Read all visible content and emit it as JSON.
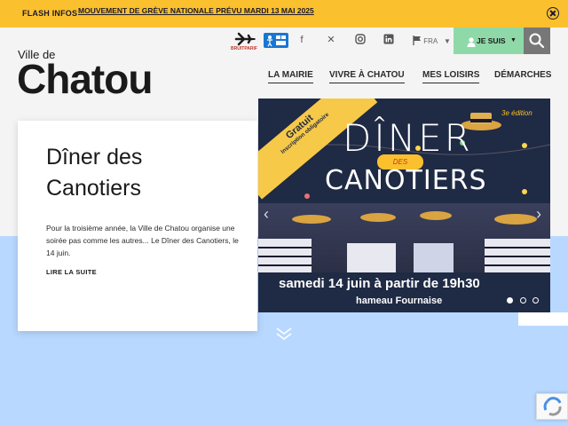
{
  "flash": {
    "label": "FLASH INFOS",
    "message": "MOUVEMENT DE GRÈVE NATIONALE PRÉVU MARDI 13 MAI 2025"
  },
  "header": {
    "logo_small": "Ville de",
    "logo_big": "Chatou",
    "bruitparif_label": "BRUITPARIF",
    "lang": "FRA",
    "je_suis": "JE SUIS",
    "social": [
      "facebook-icon",
      "x-icon",
      "instagram-icon",
      "linkedin-icon"
    ]
  },
  "nav": {
    "items": [
      "LA MAIRIE",
      "VIVRE À CHATOU",
      "MES LOISIRS",
      "DÉMARCHES"
    ]
  },
  "card": {
    "title": "Dîner des Canotiers",
    "text": "Pour la troisième année, la Ville de Chatou organise une soirée pas comme les autres... Le Dîner des Canotiers, le 14 juin.",
    "link": "LIRE LA SUITE"
  },
  "banner": {
    "title_line1": "DÎNER",
    "des": "DES",
    "title_line2": "CANOTIERS",
    "edition": "3e édition",
    "gratuit": "Gratuit",
    "inscription": "Inscription obligatoire",
    "date": "samedi 14 juin à partir de 19h30",
    "place": "hameau Fournaise",
    "slide_count": 3,
    "active_slide": 1
  },
  "colors": {
    "flash_bg": "#fbc02d",
    "je_suis_bg": "#8fd9a8",
    "banner_bg": "#1f2a44",
    "lower_band": "#b8d8ff"
  }
}
